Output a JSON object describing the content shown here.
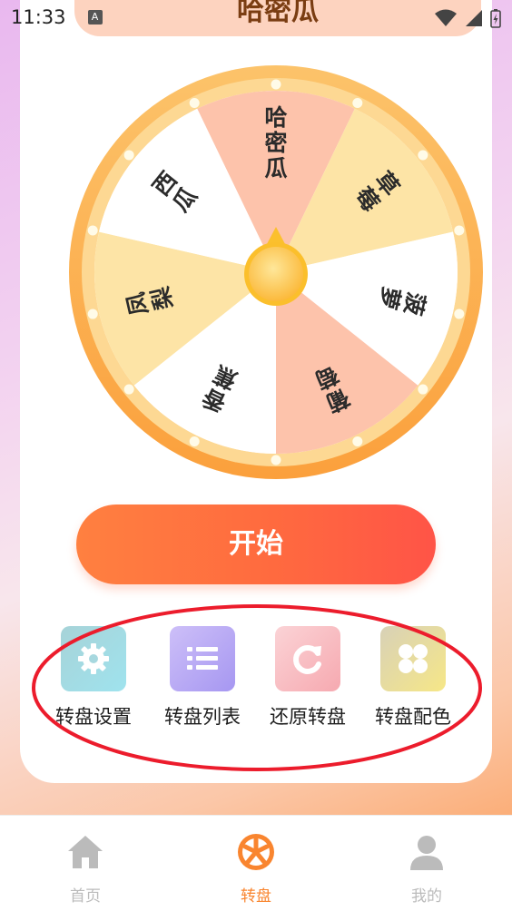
{
  "status_bar": {
    "time": "11:33",
    "notification_badge": "A"
  },
  "header": {
    "title": "哈密瓜"
  },
  "wheel": {
    "segments": [
      {
        "label": "哈密瓜",
        "color": "#fdc3ab"
      },
      {
        "label": "草莓",
        "color": "#fde4a6"
      },
      {
        "label": "菠萝",
        "color": "#ffffff"
      },
      {
        "label": "葡萄",
        "color": "#fdc3ab"
      },
      {
        "label": "香蕉",
        "color": "#ffffff"
      },
      {
        "label": "凤梨",
        "color": "#fde4a6"
      },
      {
        "label": "西瓜",
        "color": "#ffffff"
      }
    ],
    "pointer_color": "#fbbf2c",
    "rim_color": "#fbb04a"
  },
  "actions": {
    "start_label": "开始"
  },
  "tools": [
    {
      "label": "转盘设置",
      "icon": "gear-icon"
    },
    {
      "label": "转盘列表",
      "icon": "list-icon"
    },
    {
      "label": "还原转盘",
      "icon": "refresh-icon"
    },
    {
      "label": "转盘配色",
      "icon": "palette-icon"
    }
  ],
  "tabbar": {
    "tabs": [
      {
        "label": "首页",
        "icon": "home-icon",
        "active": false
      },
      {
        "label": "转盘",
        "icon": "wheel-icon",
        "active": true
      },
      {
        "label": "我的",
        "icon": "user-icon",
        "active": false
      }
    ],
    "active_color": "#f9852f",
    "inactive_color": "#bbbbbb"
  }
}
